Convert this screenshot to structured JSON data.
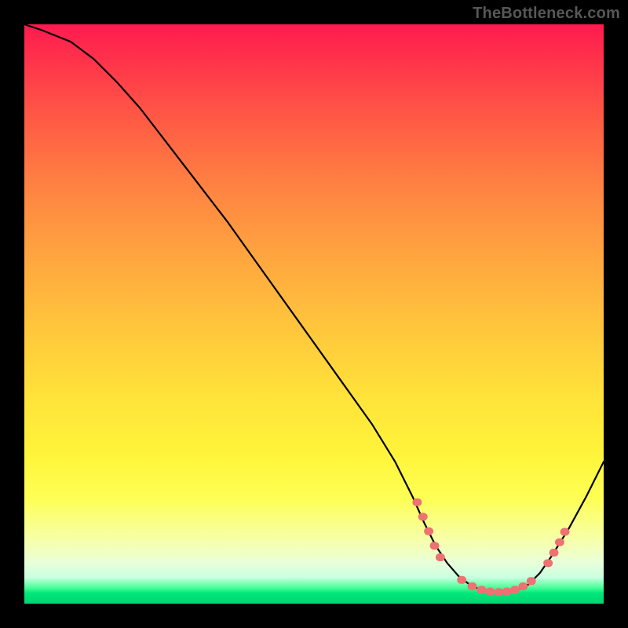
{
  "watermark": "TheBottleneck.com",
  "colors": {
    "frame": "#000000",
    "curve_stroke": "#000000",
    "marker_fill": "#ed7271",
    "gradient_stops": [
      "#ff1a4f",
      "#ff3a4a",
      "#ff6044",
      "#ff8242",
      "#ffa53f",
      "#ffc53c",
      "#ffe23a",
      "#fff43a",
      "#feff55",
      "#f6ffb0",
      "#e8ffda",
      "#c8ffdf",
      "#4cff9a",
      "#00e77a",
      "#00d571"
    ]
  },
  "chart_data": {
    "type": "line",
    "title": "",
    "xlabel": "",
    "ylabel": "",
    "xlim": [
      0,
      100
    ],
    "ylim": [
      0,
      100
    ],
    "series": [
      {
        "name": "curve",
        "x": [
          0,
          3,
          8,
          12,
          16,
          20,
          25,
          30,
          35,
          40,
          45,
          50,
          55,
          60,
          64,
          67,
          69,
          71,
          73,
          75,
          77,
          79,
          81,
          83,
          85,
          87,
          89,
          91,
          94,
          97,
          100
        ],
        "y": [
          100,
          99,
          97,
          94,
          90,
          85.5,
          79,
          72.5,
          66,
          59,
          52,
          45,
          38,
          31,
          24.5,
          18.5,
          14,
          10,
          7,
          4.7,
          3.2,
          2.3,
          2.0,
          2.0,
          2.3,
          3.3,
          5.3,
          8.2,
          13.0,
          18.5,
          24.5
        ]
      }
    ],
    "markers": [
      {
        "x": 67.8,
        "y": 17.5
      },
      {
        "x": 68.8,
        "y": 15.0
      },
      {
        "x": 69.8,
        "y": 12.5
      },
      {
        "x": 70.8,
        "y": 10.0
      },
      {
        "x": 71.8,
        "y": 8.0
      },
      {
        "x": 75.5,
        "y": 4.1
      },
      {
        "x": 77.3,
        "y": 3.0
      },
      {
        "x": 78.9,
        "y": 2.4
      },
      {
        "x": 80.4,
        "y": 2.1
      },
      {
        "x": 81.9,
        "y": 2.0
      },
      {
        "x": 83.3,
        "y": 2.1
      },
      {
        "x": 84.7,
        "y": 2.4
      },
      {
        "x": 86.1,
        "y": 3.0
      },
      {
        "x": 87.5,
        "y": 3.9
      },
      {
        "x": 90.4,
        "y": 7.0
      },
      {
        "x": 91.4,
        "y": 8.8
      },
      {
        "x": 92.4,
        "y": 10.6
      },
      {
        "x": 93.3,
        "y": 12.4
      }
    ]
  }
}
